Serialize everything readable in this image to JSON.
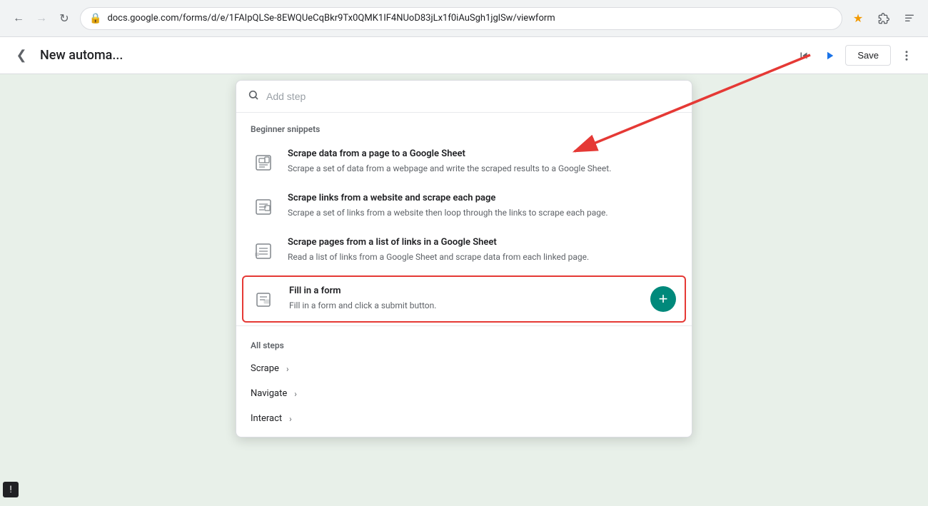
{
  "browser": {
    "url": "docs.google.com/forms/d/e/1FAIpQLSe-8EWQUeCqBkr9Tx0QMK1IF4NUoD83jLx1f0iAuSgh1jglSw/viewform",
    "back_disabled": false,
    "forward_disabled": false
  },
  "app": {
    "title": "New automa...",
    "save_label": "Save"
  },
  "panel": {
    "search_placeholder": "Add step",
    "section_beginner": "Beginner snippets",
    "section_all": "All steps",
    "snippets": [
      {
        "id": "snippet-1",
        "title": "Scrape data from a page to a Google Sheet",
        "desc": "Scrape a set of data from a webpage and write the scraped results to a Google Sheet.",
        "highlighted": false
      },
      {
        "id": "snippet-2",
        "title": "Scrape links from a website and scrape each page",
        "desc": "Scrape a set of links from a website then loop through the links to scrape each page.",
        "highlighted": false
      },
      {
        "id": "snippet-3",
        "title": "Scrape pages from a list of links in a Google Sheet",
        "desc": "Read a list of links from a Google Sheet and scrape data from each linked page.",
        "highlighted": false
      },
      {
        "id": "snippet-4",
        "title": "Fill in a form",
        "desc": "Fill in a form and click a submit button.",
        "highlighted": true
      }
    ],
    "steps": [
      {
        "label": "Scrape",
        "id": "step-scrape"
      },
      {
        "label": "Navigate",
        "id": "step-navigate"
      },
      {
        "label": "Interact",
        "id": "step-interact"
      }
    ]
  },
  "warning": {
    "icon": "!"
  },
  "icons": {
    "back": "◀",
    "search": "🔍",
    "star": "★",
    "extensions": "🧩",
    "menu": "⋮",
    "lock": "🔒",
    "reload": "↻",
    "play": "▶",
    "plus": "+",
    "chevron_right": "›",
    "warning": "!"
  }
}
